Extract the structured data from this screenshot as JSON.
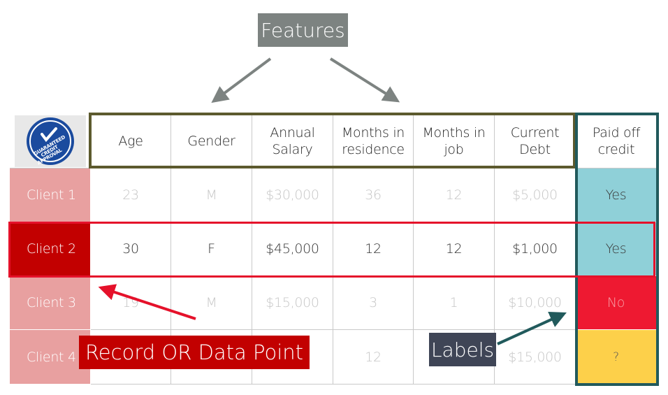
{
  "callouts": {
    "features": "Features",
    "record": "Record OR Data Point",
    "labels": "Labels"
  },
  "logo": {
    "alt_text": "GUARANTEED CREDIT APPROVAL"
  },
  "table": {
    "columns": [
      "Age",
      "Gender",
      "Annual Salary",
      "Months in residence",
      "Months in job",
      "Current Debt",
      "Paid off credit"
    ],
    "rows": [
      {
        "client": "Client 1",
        "values": [
          "23",
          "M",
          "$30,000",
          "36",
          "12",
          "$5,000"
        ],
        "label": "Yes"
      },
      {
        "client": "Client 2",
        "values": [
          "30",
          "F",
          "$45,000",
          "12",
          "12",
          "$1,000"
        ],
        "label": "Yes"
      },
      {
        "client": "Client 3",
        "values": [
          "19",
          "M",
          "$15,000",
          "3",
          "1",
          "$10,000"
        ],
        "label": "No"
      },
      {
        "client": "Client 4",
        "values": [
          "",
          "",
          "",
          "12",
          "",
          "$15,000"
        ],
        "label": "?"
      }
    ]
  },
  "colors": {
    "features_box": "#5c5a2e",
    "labels_box": "#215a5c",
    "highlight": "#e5112a",
    "client_faded": "#e8a0a0",
    "client_active": "#c20000",
    "yes": "#8fd0d8",
    "no": "#ee1931",
    "unknown": "#fdd04a",
    "feature_tag": "#7d8381",
    "label_tag": "#3f4556"
  }
}
